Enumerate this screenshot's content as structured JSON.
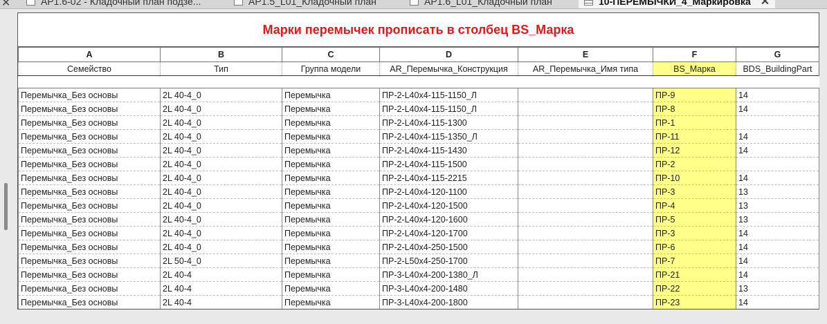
{
  "tabs": [
    {
      "label": "АР1.6-02 - Кладочный план подзе...",
      "icon": "floorplan-icon"
    },
    {
      "label": "АР1.5_L01_Кладочный план",
      "icon": "floorplan-icon"
    },
    {
      "label": "АР1.6_L01_Кладочный план",
      "icon": "floorplan-icon"
    },
    {
      "label": "10-ПЕРЕМЫЧКИ_4_Маркировка",
      "icon": "schedule-icon",
      "active": true
    }
  ],
  "schedule": {
    "title": "Марки перемычек прописать в столбец BS_Марка",
    "column_letters": [
      "A",
      "B",
      "C",
      "D",
      "E",
      "F",
      "G"
    ],
    "headers": [
      "Семейство",
      "Тип",
      "Группа модели",
      "AR_Перемычка_Конструкция",
      "AR_Перемычка_Имя типа",
      "BS_Марка",
      "BDS_BuildingPart"
    ],
    "highlight_column": "F",
    "highlight_color": "#ffff8a",
    "title_color": "#e41818",
    "rows": [
      [
        "Перемычка_Без основы",
        "2L 40-4_0",
        "Перемычка",
        "ПР-2-L40x4-115-1150_Л",
        "",
        "ПР-9",
        "14"
      ],
      [
        "Перемычка_Без основы",
        "2L 40-4_0",
        "Перемычка",
        "ПР-2-L40x4-115-1150_Л",
        "",
        "ПР-8",
        "14"
      ],
      [
        "Перемычка_Без основы",
        "2L 40-4_0",
        "Перемычка",
        "ПР-2-L40x4-115-1300",
        "",
        "ПР-1",
        ""
      ],
      [
        "Перемычка_Без основы",
        "2L 40-4_0",
        "Перемычка",
        "ПР-2-L40x4-115-1350_Л",
        "",
        "ПР-11",
        "14"
      ],
      [
        "Перемычка_Без основы",
        "2L 40-4_0",
        "Перемычка",
        "ПР-2-L40x4-115-1430",
        "",
        "ПР-12",
        "14"
      ],
      [
        "Перемычка_Без основы",
        "2L 40-4_0",
        "Перемычка",
        "ПР-2-L40x4-115-1500",
        "",
        "ПР-2",
        ""
      ],
      [
        "Перемычка_Без основы",
        "2L 40-4_0",
        "Перемычка",
        "ПР-2-L40x4-115-2215",
        "",
        "ПР-10",
        "14"
      ],
      [
        "Перемычка_Без основы",
        "2L 40-4_0",
        "Перемычка",
        "ПР-2-L40x4-120-1100",
        "",
        "ПР-3",
        "13"
      ],
      [
        "Перемычка_Без основы",
        "2L 40-4_0",
        "Перемычка",
        "ПР-2-L40x4-120-1500",
        "",
        "ПР-4",
        "13"
      ],
      [
        "Перемычка_Без основы",
        "2L 40-4_0",
        "Перемычка",
        "ПР-2-L40x4-120-1600",
        "",
        "ПР-5",
        "13"
      ],
      [
        "Перемычка_Без основы",
        "2L 40-4_0",
        "Перемычка",
        "ПР-2-L40x4-120-1700",
        "",
        "ПР-3",
        "14"
      ],
      [
        "Перемычка_Без основы",
        "2L 40-4_0",
        "Перемычка",
        "ПР-2-L40x4-250-1500",
        "",
        "ПР-6",
        "14"
      ],
      [
        "Перемычка_Без основы",
        "2L 50-4_0",
        "Перемычка",
        "ПР-2-L50x4-250-1700",
        "",
        "ПР-7",
        "14"
      ],
      [
        "Перемычка_Без основы",
        "2L 40-4",
        "Перемычка",
        "ПР-3-L40x4-200-1380_Л",
        "",
        "ПР-21",
        "14"
      ],
      [
        "Перемычка_Без основы",
        "2L 40-4",
        "Перемычка",
        "ПР-3-L40x4-200-1480",
        "",
        "ПР-22",
        "13"
      ],
      [
        "Перемычка_Без основы",
        "2L 40-4",
        "Перемычка",
        "ПР-3-L40x4-200-1800",
        "",
        "ПР-23",
        "14"
      ]
    ]
  }
}
